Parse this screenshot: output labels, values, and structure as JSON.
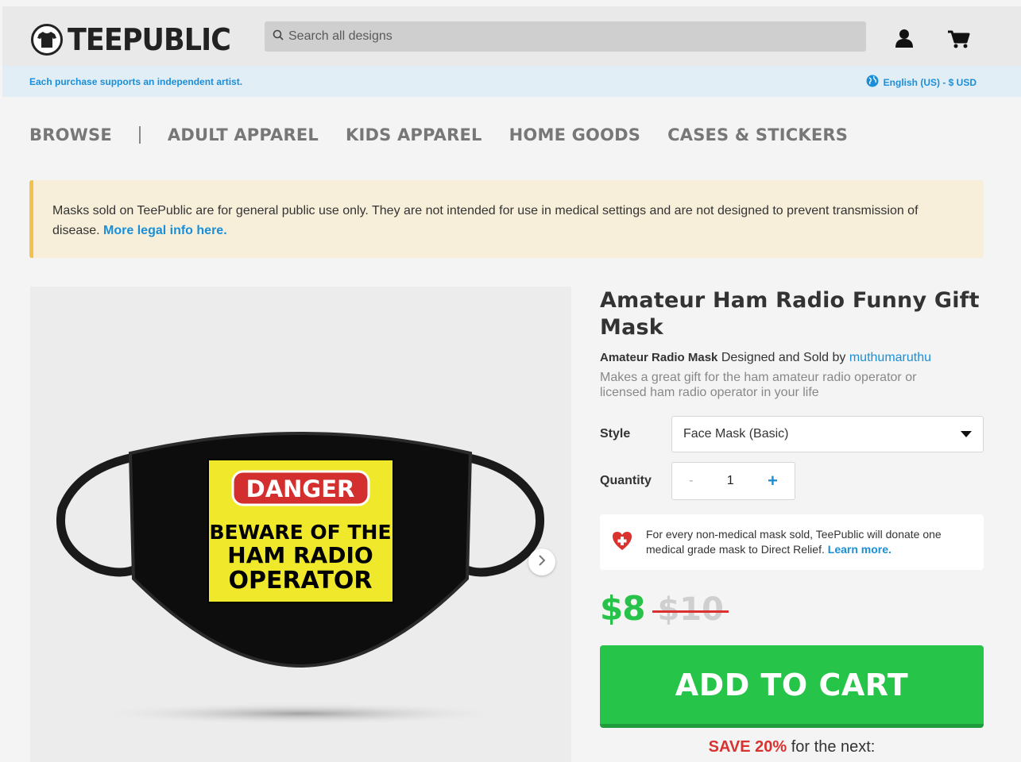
{
  "header": {
    "logo_text": "TEEPUBLIC",
    "search_placeholder": "Search all designs"
  },
  "artist_bar": {
    "message": "Each purchase supports an independent artist.",
    "locale": "English (US) - $ USD"
  },
  "nav": {
    "items": [
      "BROWSE",
      "ADULT APPAREL",
      "KIDS APPAREL",
      "HOME GOODS",
      "CASES & STICKERS"
    ]
  },
  "notice": {
    "text": "Masks sold on TeePublic are for general public use only. They are not intended for use in medical settings and are not designed to prevent transmission of disease.",
    "link": "More legal info here."
  },
  "product": {
    "title": "Amateur Ham Radio Funny Gift Mask",
    "product_name": "Amateur Radio Mask",
    "designed_by": "Designed and Sold by",
    "artist": "muthumaruthu",
    "description": "Makes a great gift for the ham amateur radio operator or licensed ham radio operator in your life",
    "style_label": "Style",
    "style_value": "Face Mask (Basic)",
    "quantity_label": "Quantity",
    "quantity_value": "1",
    "quantity_minus": "-",
    "quantity_plus": "+",
    "mask_print": {
      "badge": "DANGER",
      "line1": "BEWARE OF THE",
      "line2": "HAM RADIO",
      "line3": "OPERATOR"
    }
  },
  "donate": {
    "text": "For every non-medical mask sold, TeePublic will donate one medical grade mask to Direct Relief.",
    "link": "Learn more."
  },
  "pricing": {
    "price": "$8",
    "original_price": "$10",
    "add_to_cart": "ADD TO CART",
    "save_highlight": "SAVE 20%",
    "save_rest": "for the next:"
  },
  "colors": {
    "accent_blue": "#1a8fd8",
    "cart_green": "#27c44a",
    "sale_red": "#d9322f",
    "notice_border": "#f2c14e"
  }
}
